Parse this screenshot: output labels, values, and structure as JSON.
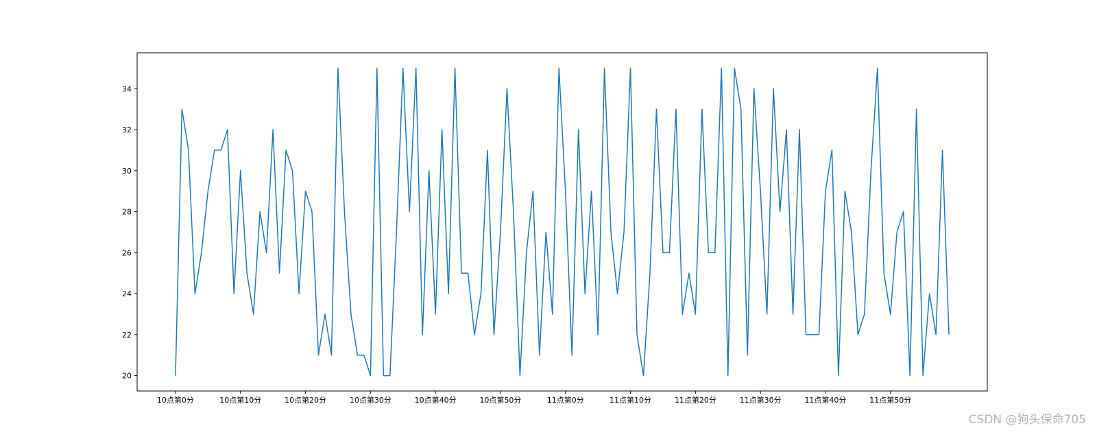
{
  "chart_data": {
    "type": "line",
    "title": "",
    "xlabel": "",
    "ylabel": "",
    "x_tick_labels": [
      "10点第0分",
      "10点第10分",
      "10点第20分",
      "10点第30分",
      "10点第40分",
      "10点第50分",
      "11点第0分",
      "11点第10分",
      "11点第20分",
      "11点第30分",
      "11点第40分",
      "11点第50分"
    ],
    "x_tick_positions": [
      0,
      10,
      20,
      30,
      40,
      50,
      60,
      70,
      80,
      90,
      100,
      110
    ],
    "xlim": [
      -5.9,
      124.9
    ],
    "ylim": [
      19.25,
      35.75
    ],
    "y_ticks": [
      20,
      22,
      24,
      26,
      28,
      30,
      32,
      34
    ],
    "grid": false,
    "legend": "none",
    "series": [
      {
        "color": "#1f77b4",
        "values": [
          20,
          33,
          31,
          24,
          26,
          29,
          31,
          31,
          32,
          24,
          30,
          25,
          23,
          28,
          26,
          32,
          25,
          31,
          30,
          24,
          29,
          28,
          21,
          23,
          21,
          35,
          28,
          23,
          21,
          21,
          20,
          35,
          20,
          20,
          27,
          35,
          28,
          35,
          22,
          30,
          23,
          32,
          24,
          35,
          25,
          25,
          22,
          24,
          31,
          22,
          27,
          34,
          28,
          20,
          26,
          29,
          21,
          27,
          23,
          35,
          29,
          21,
          32,
          24,
          29,
          22,
          35,
          27,
          24,
          27,
          35,
          22,
          20,
          25,
          33,
          26,
          26,
          33,
          23,
          25,
          23,
          33,
          26,
          26,
          35,
          20,
          35,
          33,
          21,
          34,
          29,
          23,
          34,
          28,
          32,
          23,
          32,
          22,
          22,
          22,
          29,
          31,
          20,
          29,
          27,
          22,
          23,
          30,
          35,
          25,
          23,
          27,
          28,
          20,
          33,
          20,
          24,
          22,
          31,
          22
        ]
      }
    ]
  },
  "watermark": "CSDN @狗头保命705"
}
